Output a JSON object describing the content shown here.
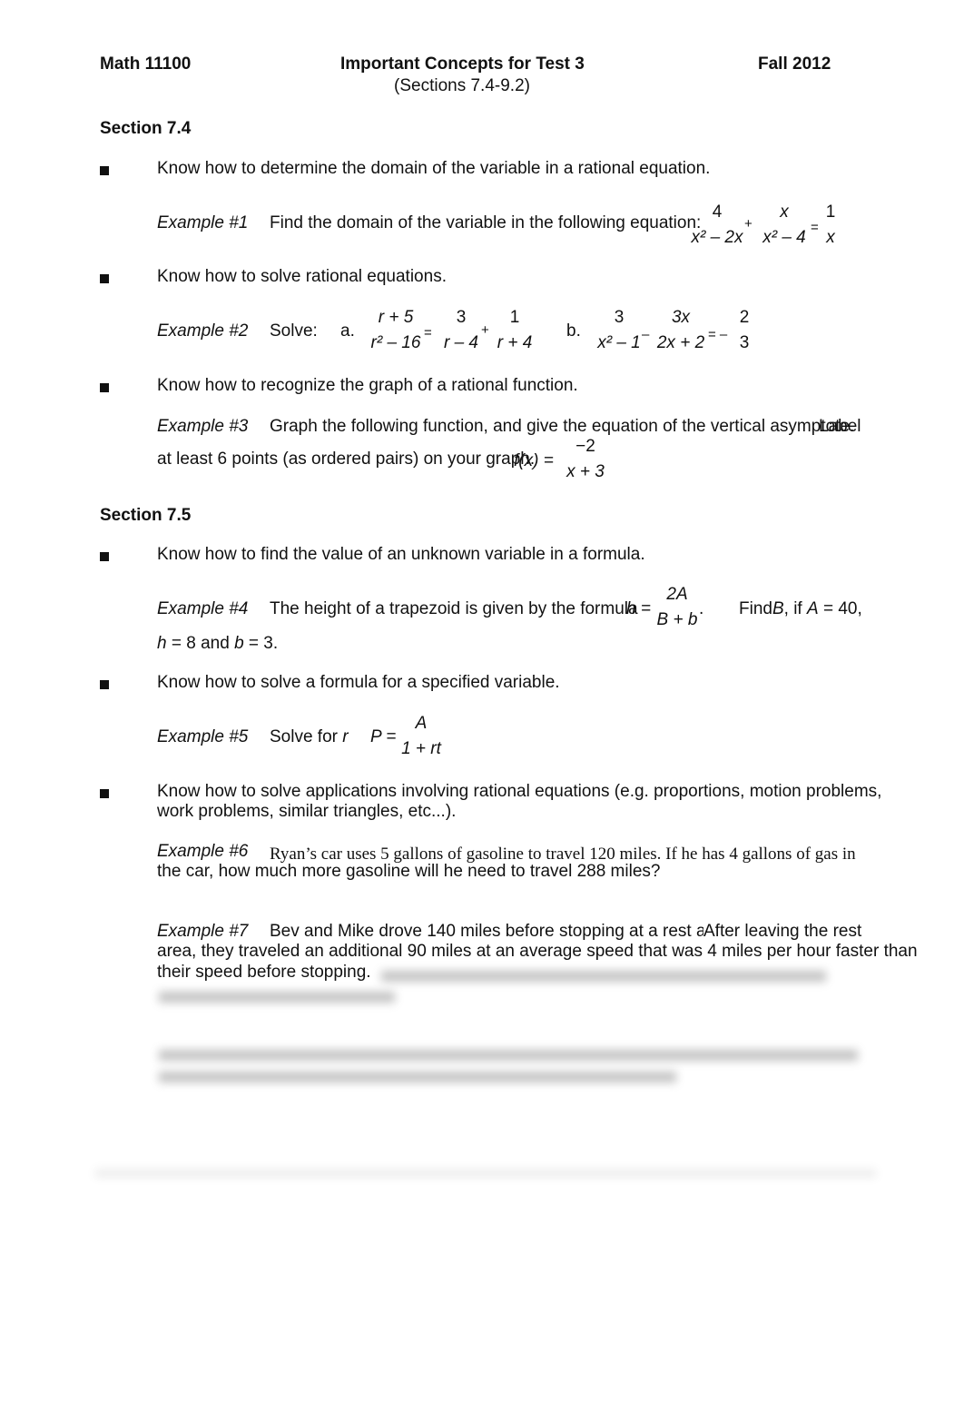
{
  "header": {
    "course": "Math 11100",
    "title": "Important Concepts for Test 3",
    "term": "Fall 2012",
    "subtitle": "(Sections 7.4-9.2)"
  },
  "sections": [
    {
      "heading": "Section 7.4"
    },
    {
      "heading": "Section 7.5"
    }
  ],
  "concepts": [
    "Know how to determine the domain of the variable in a rational equation.",
    "Know how to solve rational equations.",
    "Know how to recognize the graph of a rational function.",
    "Know how to find the value of an unknown variable in a formula.",
    "Know how to solve a formula for a specified variable.",
    "Know how to solve applications involving rational equations (e.g. proportions, motion problems,",
    "work problems, similar triangles, etc...)."
  ],
  "examples": {
    "ex1": {
      "label": "Example #1",
      "text": "Find the domain of the variable in the following equation:"
    },
    "ex2": {
      "label": "Example #2",
      "text": "Solve:",
      "a": "a.",
      "b": "b."
    },
    "ex3": {
      "label": "Example #3",
      "text": "Graph the following function, and give the equation of the vertical asymptote.",
      "text_overlap": "Label",
      "line2": "at least 6 points (as ordered pairs) on your graph."
    },
    "ex4": {
      "label": "Example #4",
      "text": "The height of a trapezoid is given by the formula",
      "find": "Find",
      "findvar": "B",
      "cond": ", if",
      "A": "A",
      "Aval": "= 40,",
      "line2h": "h",
      "line2a": "= 8 and",
      "line2b": "b",
      "line2c": "= 3."
    },
    "ex5": {
      "label": "Example #5",
      "text": "Solve for",
      "var": "r"
    },
    "ex6": {
      "label": "Example #6",
      "text": "Ryan’s car uses 5 gallons of gasoline to travel 120 miles.   If he has 4 gallons of gas in",
      "line2": "the car, how much more gasoline will he need to travel 288 miles?"
    },
    "ex7": {
      "label": "Example #7",
      "text": "Bev and Mike drove 140 miles before stopping at a rest area.",
      "overlap": "After leaving the rest",
      "line2": "area, they traveled an additional 90 miles at an average speed that was 4 miles per hour faster than",
      "line3": "their speed before stopping."
    }
  },
  "math": {
    "eq1": {
      "f1n": "4",
      "f1d": "x² – 2x",
      "op1": "+",
      "f2n": "x",
      "f2d": "x² – 4",
      "op2": "=",
      "f3n": "1",
      "f3d": "x"
    },
    "eq2a": {
      "f1n": "r + 5",
      "f1d": "r² – 16",
      "op1": "=",
      "f2n": "3",
      "f2d": "r – 4",
      "op2": "+",
      "f3n": "1",
      "f3d": "r + 4"
    },
    "eq2b": {
      "f1n": "3",
      "f1d": "x² – 1",
      "op1": "–",
      "f2n": "3x",
      "f2d": "2x + 2",
      "op2": "= –",
      "f3n": "2",
      "f3d": "3"
    },
    "eq3": {
      "lhs": "f(x) =",
      "n": "−2",
      "d": "x + 3"
    },
    "eq4": {
      "lhs": "h =",
      "n": "2A",
      "d": "B + b",
      "dot": "."
    },
    "eq5": {
      "lhs": "P =",
      "n": "A",
      "d": "1 + rt"
    }
  }
}
